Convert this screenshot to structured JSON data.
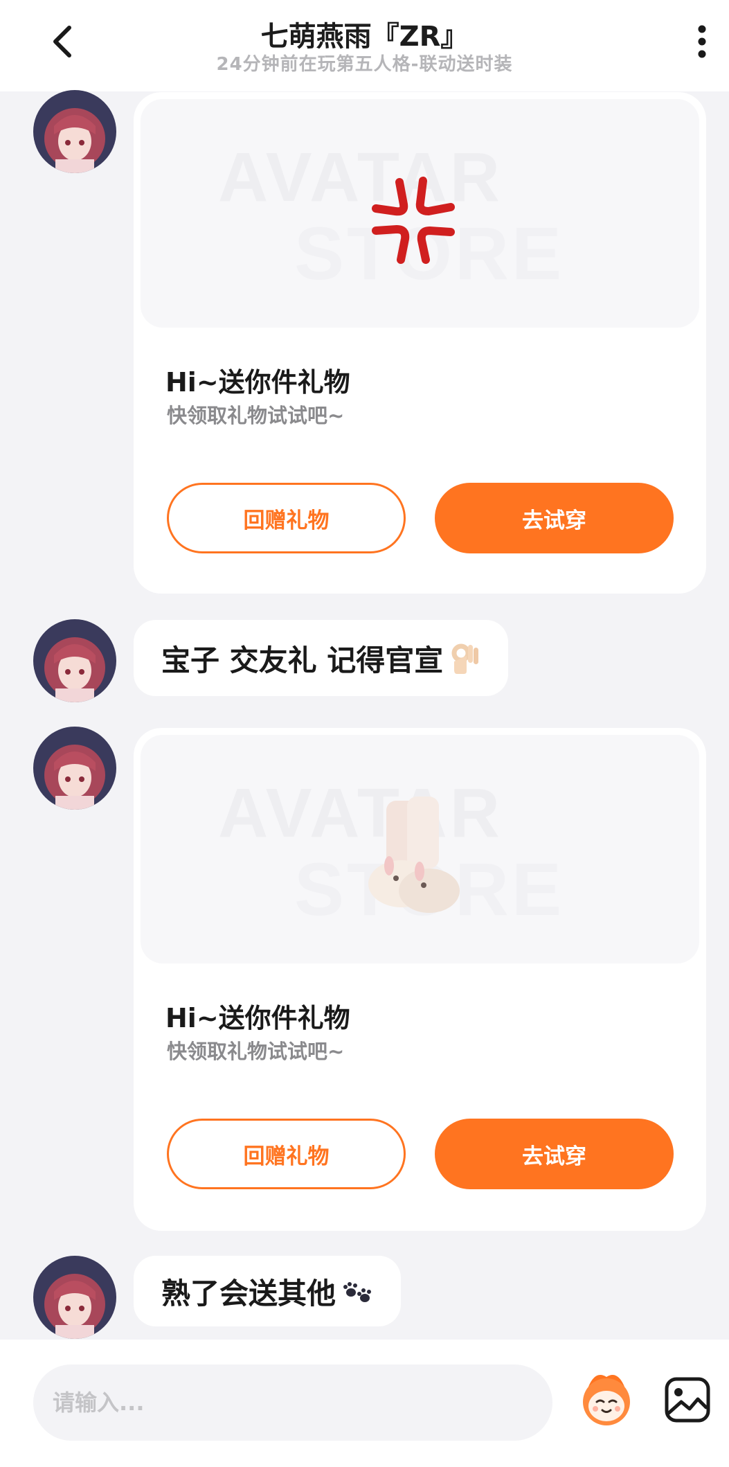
{
  "header": {
    "title": "七萌燕雨『ZR』",
    "subtitle": "24分钟前在玩第五人格-联动送时装"
  },
  "messages": [
    {
      "type": "gift",
      "watermark_line1": "AVATAR",
      "watermark_line2": "STORE",
      "title": "Hi~送你件礼物",
      "subtitle": "快领取礼物试试吧~",
      "return_gift_label": "回赠礼物",
      "try_on_label": "去试穿"
    },
    {
      "type": "text",
      "text": "宝子 交友礼 记得官宣"
    },
    {
      "type": "gift",
      "watermark_line1": "AVATAR",
      "watermark_line2": "STORE",
      "title": "Hi~送你件礼物",
      "subtitle": "快领取礼物试试吧~",
      "return_gift_label": "回赠礼物",
      "try_on_label": "去试穿"
    },
    {
      "type": "text",
      "text": "熟了会送其他"
    }
  ],
  "input": {
    "placeholder": "请输入..."
  },
  "colors": {
    "accent": "#ff7420",
    "background": "#f3f3f6"
  }
}
